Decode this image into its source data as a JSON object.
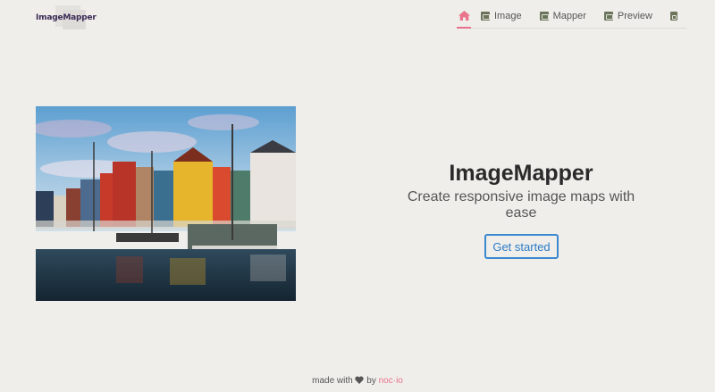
{
  "app": {
    "logo_text": "ImageMapper"
  },
  "nav": {
    "items": [
      {
        "label": "",
        "icon": "home-icon"
      },
      {
        "label": "Image",
        "icon": "image-icon"
      },
      {
        "label": "Mapper",
        "icon": "mapper-icon"
      },
      {
        "label": "Preview",
        "icon": "preview-icon"
      },
      {
        "label": "",
        "icon": "download-icon"
      }
    ],
    "active_color": "#e9738a"
  },
  "hero": {
    "title": "ImageMapper",
    "subtitle": "Create responsive image maps with ease",
    "cta_label": "Get started",
    "cta_color": "#3a88cf"
  },
  "footer": {
    "prefix": "made with",
    "heart_icon": "heart-icon",
    "by": "by",
    "brand": "noc·io"
  }
}
